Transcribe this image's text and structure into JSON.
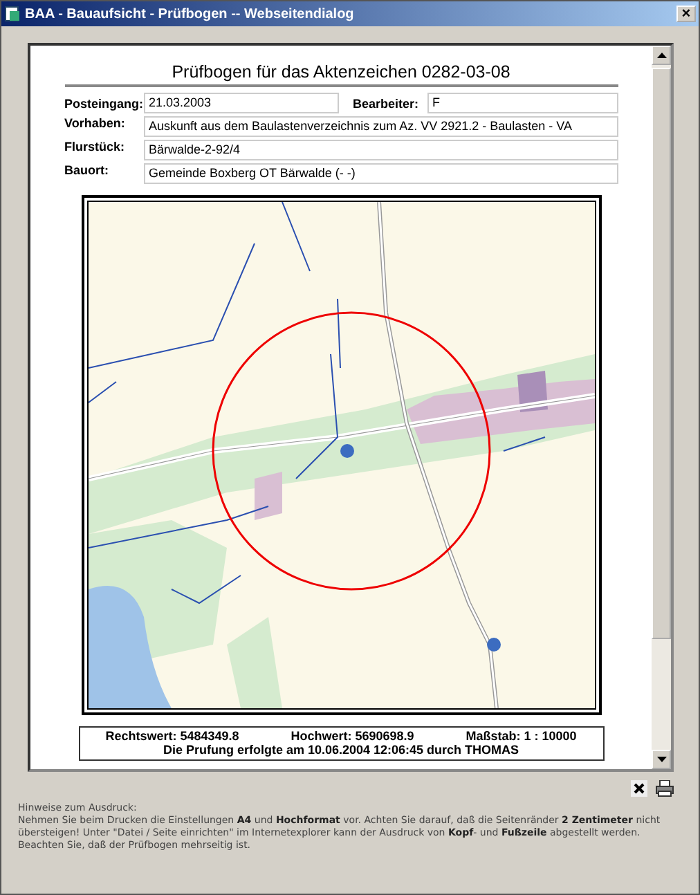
{
  "window": {
    "title": "BAA - Bauaufsicht - Prüfbogen -- Webseitendialog",
    "close": "×"
  },
  "heading": "Prüfbogen für das Aktenzeichen 0282-03-08",
  "fields": [
    {
      "label": "Posteingang:",
      "value": "21.03.2003"
    },
    {
      "label": "Bearbeiter:",
      "value": "F"
    },
    {
      "label": "Vorhaben:",
      "value": "Auskunft aus dem Baulastenverzeichnis zum Az. VV 2921.2 - Baulasten - VA"
    },
    {
      "label": "Flurstück:",
      "value": "Bärwalde-2-92/4"
    },
    {
      "label": "Bauort:",
      "value": "Gemeinde Boxberg OT Bärwalde (- -)"
    }
  ],
  "info": {
    "rechtswert": "Rechtswert: 5484349.8",
    "hochwert": "Hochwert: 5690698.9",
    "massstab": "Maßstab: 1 : 10000",
    "pruefung": "Die Prufung erfolgte am 10.06.2004 12:06:45 durch THOMAS"
  },
  "hints": {
    "title": "Hinweise zum Ausdruck:",
    "text": "Nehmen Sie beim Drucken die Einstellungen **A4** und **Hochformat** vor.  Achten Sie darauf, daß die Seitenränder **2 Zentimeter** nicht übersteigen!  Unter \"Datei / Seite einrichten\" im Internetexplorer kann der Ausdruck von **Kopf**- und **Fußzeile** abgestellt werden.  Beachten Sie, daß der Prüfbogen mehrseitig ist."
  }
}
